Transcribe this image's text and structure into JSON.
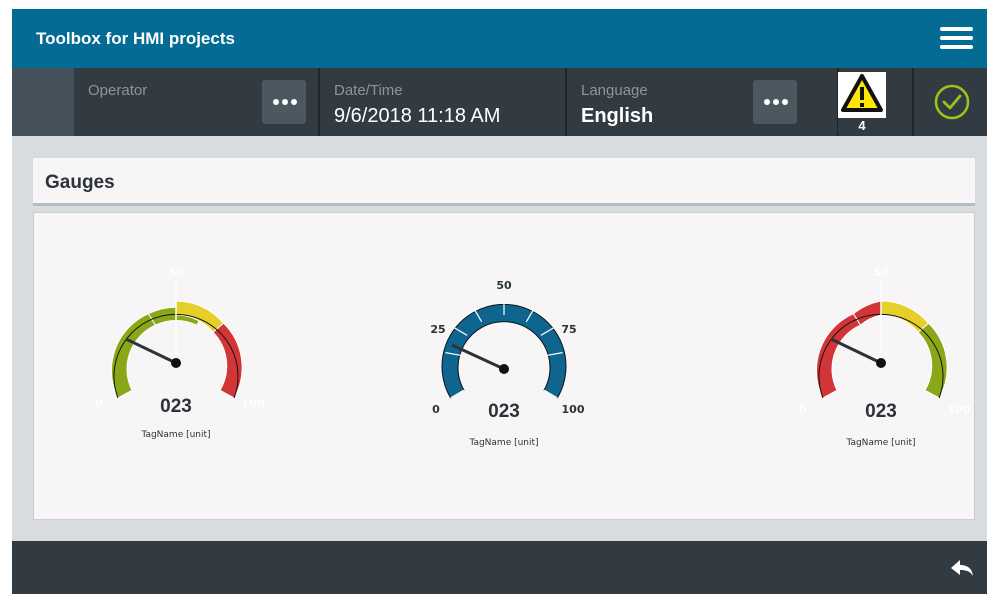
{
  "header": {
    "title": "Toolbox for HMI projects"
  },
  "statusbar": {
    "operator_label": "Operator",
    "operator_value": "",
    "datetime_label": "Date/Time",
    "datetime_value": "9/6/2018 11:18 AM",
    "language_label": "Language",
    "language_value": "English",
    "alarm_count": "4",
    "alarm_icon": "warning-icon",
    "status_icon": "check-circle-icon"
  },
  "section": {
    "title": "Gauges"
  },
  "gauges": [
    {
      "id": "gauge-1",
      "style": "traffic-green-yellow-red",
      "value": 23,
      "value_label": "023",
      "tag": "TagName [unit]",
      "ticks": [
        "0",
        "50",
        "100"
      ],
      "colors": [
        "#8aa717",
        "#e7cf2a",
        "#d23537"
      ]
    },
    {
      "id": "gauge-2",
      "style": "blue-segmented",
      "value": 23,
      "value_label": "023",
      "tag": "TagName [unit]",
      "ticks": [
        "0",
        "25",
        "50",
        "75",
        "100"
      ],
      "colors": [
        "#0e6690"
      ]
    },
    {
      "id": "gauge-3",
      "style": "traffic-red-yellow-green",
      "value": 23,
      "value_label": "023",
      "tag": "TagName [unit]",
      "ticks": [
        "0",
        "50",
        "100"
      ],
      "colors": [
        "#d23537",
        "#e7cf2a",
        "#8aa717"
      ]
    }
  ],
  "colors": {
    "header": "#046b95",
    "statusbar": "#323b42",
    "content_bg": "#d9dcdf",
    "panel_bg": "#f7f5f6",
    "ok_green": "#9ac31c",
    "warning_yellow": "#ffe800"
  },
  "footer": {
    "back_icon": "back-arrow-icon"
  }
}
